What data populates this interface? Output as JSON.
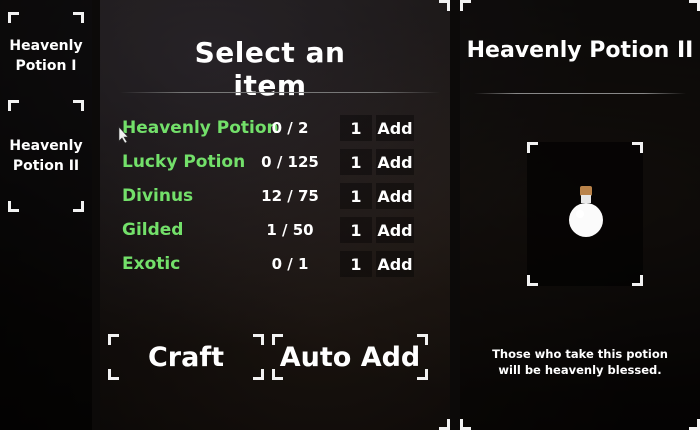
{
  "sidebar": {
    "items": [
      {
        "label_line1": "Heavenly",
        "label_line2": "Potion I"
      },
      {
        "label_line1": "Heavenly",
        "label_line2": "Potion II"
      }
    ]
  },
  "main": {
    "title": "Select an item",
    "requirements": [
      {
        "name": "Heavenly Potion",
        "count": "0 / 2",
        "qty": "1",
        "add_label": "Add"
      },
      {
        "name": "Lucky Potion",
        "count": "0 / 125",
        "qty": "1",
        "add_label": "Add"
      },
      {
        "name": "Divinus",
        "count": "12 / 75",
        "qty": "1",
        "add_label": "Add"
      },
      {
        "name": "Gilded",
        "count": "1 / 50",
        "qty": "1",
        "add_label": "Add"
      },
      {
        "name": "Exotic",
        "count": "0 / 1",
        "qty": "1",
        "add_label": "Add"
      }
    ],
    "craft_label": "Craft",
    "auto_add_label": "Auto Add"
  },
  "detail": {
    "title": "Heavenly Potion II",
    "description_line1": "Those who take this potion",
    "description_line2": "will be heavenly blessed."
  },
  "colors": {
    "requirement_name": "#73e06a",
    "text": "#ffffff",
    "bracket": "#f2f2f2"
  },
  "icons": {
    "preview": "potion-bottle-icon"
  }
}
